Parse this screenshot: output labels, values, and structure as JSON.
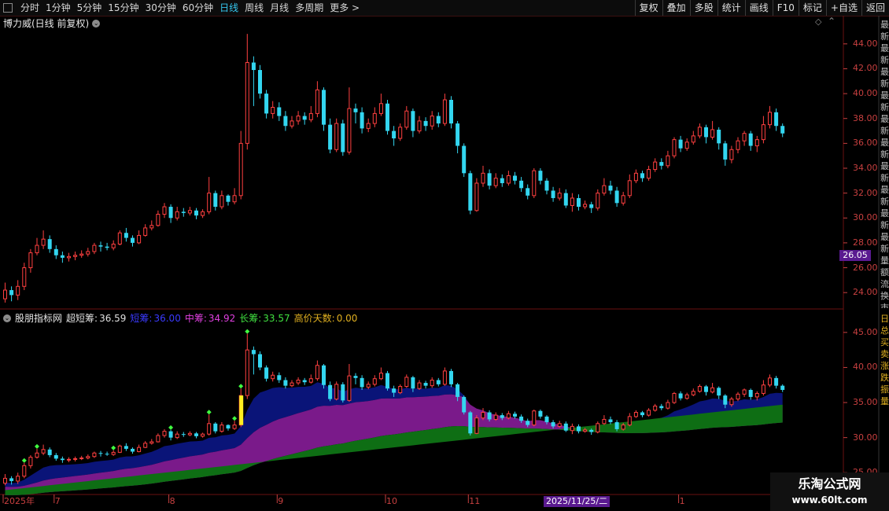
{
  "toolbar": {
    "periods": [
      "分时",
      "1分钟",
      "5分钟",
      "15分钟",
      "30分钟",
      "60分钟",
      "日线",
      "周线",
      "月线",
      "多周期",
      "更多 >"
    ],
    "active_period": "日线",
    "right_buttons": [
      "复权",
      "叠加",
      "多股",
      "统计",
      "画线",
      "F10",
      "标记",
      "+自选",
      "返回"
    ]
  },
  "main_panel": {
    "title": "博力威(日线 前复权)",
    "y_ticks": [
      "44.00",
      "42.00",
      "40.00",
      "38.00",
      "36.00",
      "34.00",
      "32.00",
      "30.00",
      "28.00",
      "26.00",
      "24.00"
    ],
    "price_tag": "26.05"
  },
  "indicator_panel": {
    "name": "股朋指标网",
    "items": [
      {
        "label": "超短筹:",
        "value": "36.59",
        "color": "#e0e0e0"
      },
      {
        "label": "短筹:",
        "value": "36.00",
        "color": "#3a3aff"
      },
      {
        "label": "中筹:",
        "value": "34.92",
        "color": "#e040e0"
      },
      {
        "label": "长筹:",
        "value": "33.57",
        "color": "#40e040"
      },
      {
        "label": "高价天数:",
        "value": "0.00",
        "color": "#e0b020"
      }
    ],
    "y_ticks": [
      "45.00",
      "40.00",
      "35.00",
      "30.00",
      "25.00"
    ]
  },
  "x_axis": {
    "labels": [
      "2025年",
      "7",
      "8",
      "9",
      "10",
      "11",
      "1"
    ],
    "cursor_date": "2025/11/25/二"
  },
  "side_text": {
    "upper": "最新最新最新最新最新最新最新最新最新最新量额流换市收",
    "lower": "日总买卖涨跌振量"
  },
  "watermark": {
    "title": "乐淘公式网",
    "url": "www.60lt.com"
  },
  "colors": {
    "up": "#ff4040",
    "down": "#33d6f0",
    "grid": "#6a1010",
    "axis": "#c84040",
    "chip_short": "#0a1478",
    "chip_mid": "#7a1a8a",
    "chip_long": "#0e6e14",
    "high_bar": "#ffee20",
    "marker": "#40ff40"
  },
  "chart_data": {
    "type": "candlestick",
    "ylim": [
      23,
      45
    ],
    "indicator_ylim": [
      22,
      47
    ],
    "candles": [
      [
        23.5,
        24.2,
        24.8,
        23.2
      ],
      [
        24.2,
        23.8,
        24.5,
        23.3
      ],
      [
        23.8,
        24.5,
        25.0,
        23.4
      ],
      [
        24.5,
        26.0,
        26.4,
        24.2
      ],
      [
        26.0,
        27.2,
        27.5,
        25.6
      ],
      [
        27.2,
        27.8,
        28.4,
        27.0
      ],
      [
        27.8,
        28.3,
        29.0,
        27.5
      ],
      [
        28.3,
        27.5,
        28.6,
        27.2
      ],
      [
        27.5,
        27.0,
        27.8,
        26.7
      ],
      [
        27.0,
        26.8,
        27.3,
        26.4
      ],
      [
        26.8,
        26.9,
        27.2,
        26.5
      ],
      [
        26.9,
        27.0,
        27.3,
        26.6
      ],
      [
        27.0,
        27.1,
        27.4,
        26.8
      ],
      [
        27.1,
        27.3,
        27.6,
        26.9
      ],
      [
        27.3,
        27.8,
        28.0,
        27.1
      ],
      [
        27.8,
        27.7,
        28.1,
        27.3
      ],
      [
        27.7,
        27.6,
        28.0,
        27.4
      ],
      [
        27.6,
        27.9,
        28.2,
        27.4
      ],
      [
        27.9,
        28.8,
        29.0,
        27.8
      ],
      [
        28.8,
        28.4,
        29.2,
        28.1
      ],
      [
        28.4,
        28.0,
        28.6,
        27.7
      ],
      [
        28.0,
        28.6,
        29.0,
        27.9
      ],
      [
        28.6,
        29.2,
        29.5,
        28.5
      ],
      [
        29.2,
        29.4,
        29.8,
        29.0
      ],
      [
        29.4,
        30.3,
        30.6,
        29.3
      ],
      [
        30.3,
        30.9,
        31.2,
        30.0
      ],
      [
        30.9,
        30.0,
        31.1,
        29.6
      ],
      [
        30.0,
        30.5,
        30.9,
        29.8
      ],
      [
        30.5,
        30.4,
        30.8,
        30.1
      ],
      [
        30.4,
        30.6,
        30.9,
        30.2
      ],
      [
        30.6,
        30.2,
        30.8,
        29.9
      ],
      [
        30.2,
        30.5,
        30.7,
        30.0
      ],
      [
        30.5,
        32.0,
        33.3,
        30.3
      ],
      [
        32.0,
        30.9,
        32.2,
        30.6
      ],
      [
        30.9,
        31.8,
        32.2,
        30.7
      ],
      [
        31.8,
        31.3,
        31.9,
        31.0
      ],
      [
        31.3,
        31.8,
        32.4,
        31.1
      ],
      [
        31.8,
        36.0,
        37.0,
        31.5
      ],
      [
        36.0,
        42.5,
        44.8,
        35.5
      ],
      [
        42.5,
        41.9,
        43.0,
        39.0
      ],
      [
        41.9,
        40.0,
        42.3,
        39.6
      ],
      [
        40.0,
        38.4,
        40.3,
        38.0
      ],
      [
        38.4,
        38.9,
        39.4,
        38.0
      ],
      [
        38.9,
        38.2,
        39.3,
        37.8
      ],
      [
        38.2,
        37.4,
        38.6,
        37.0
      ],
      [
        37.4,
        37.8,
        38.2,
        37.2
      ],
      [
        37.8,
        38.2,
        38.6,
        37.5
      ],
      [
        38.2,
        37.9,
        38.5,
        37.5
      ],
      [
        37.9,
        38.4,
        39.0,
        37.7
      ],
      [
        38.4,
        40.3,
        41.0,
        38.1
      ],
      [
        40.3,
        37.5,
        40.5,
        37.0
      ],
      [
        37.5,
        35.5,
        38.0,
        35.2
      ],
      [
        35.5,
        37.6,
        38.0,
        35.3
      ],
      [
        37.6,
        35.3,
        37.9,
        35.0
      ],
      [
        35.3,
        38.8,
        40.5,
        35.1
      ],
      [
        38.8,
        38.5,
        39.2,
        37.6
      ],
      [
        38.5,
        37.2,
        38.9,
        36.8
      ],
      [
        37.2,
        37.6,
        38.0,
        36.9
      ],
      [
        37.6,
        38.4,
        38.9,
        37.3
      ],
      [
        38.4,
        39.2,
        40.0,
        38.2
      ],
      [
        39.2,
        37.0,
        39.5,
        36.7
      ],
      [
        37.0,
        36.4,
        37.4,
        35.8
      ],
      [
        36.4,
        37.3,
        37.6,
        36.2
      ],
      [
        37.3,
        38.6,
        39.0,
        37.1
      ],
      [
        38.6,
        37.0,
        38.8,
        36.5
      ],
      [
        37.0,
        37.8,
        38.2,
        36.8
      ],
      [
        37.8,
        37.4,
        38.1,
        37.0
      ],
      [
        37.4,
        38.2,
        38.6,
        37.1
      ],
      [
        38.2,
        37.6,
        38.5,
        37.3
      ],
      [
        37.6,
        39.5,
        40.0,
        37.4
      ],
      [
        39.5,
        37.6,
        39.8,
        37.2
      ],
      [
        37.6,
        35.8,
        37.8,
        35.2
      ],
      [
        35.8,
        33.6,
        36.0,
        33.3
      ],
      [
        33.6,
        30.6,
        33.8,
        30.3
      ],
      [
        30.6,
        32.8,
        33.2,
        30.5
      ],
      [
        32.8,
        33.6,
        34.2,
        32.5
      ],
      [
        33.6,
        32.6,
        33.9,
        32.3
      ],
      [
        32.6,
        33.2,
        33.6,
        32.4
      ],
      [
        33.2,
        32.8,
        33.5,
        32.5
      ],
      [
        32.8,
        33.4,
        33.8,
        32.6
      ],
      [
        33.4,
        33.0,
        33.7,
        32.7
      ],
      [
        33.0,
        32.4,
        33.3,
        32.1
      ],
      [
        32.4,
        31.8,
        32.7,
        31.5
      ],
      [
        31.8,
        33.8,
        34.0,
        31.6
      ],
      [
        33.8,
        33.0,
        34.0,
        32.7
      ],
      [
        33.0,
        32.2,
        33.2,
        31.9
      ],
      [
        32.2,
        31.6,
        32.5,
        31.3
      ],
      [
        31.6,
        32.0,
        32.4,
        31.4
      ],
      [
        32.0,
        31.0,
        32.3,
        30.8
      ],
      [
        31.0,
        31.6,
        32.0,
        30.5
      ],
      [
        31.6,
        30.9,
        31.9,
        30.6
      ],
      [
        30.9,
        31.1,
        31.4,
        30.7
      ],
      [
        31.1,
        30.8,
        31.3,
        30.4
      ],
      [
        30.8,
        32.0,
        32.3,
        30.6
      ],
      [
        32.0,
        32.6,
        33.2,
        31.8
      ],
      [
        32.6,
        32.2,
        33.0,
        31.9
      ],
      [
        32.2,
        31.2,
        32.5,
        30.9
      ],
      [
        31.2,
        31.8,
        32.1,
        31.0
      ],
      [
        31.8,
        33.0,
        33.5,
        31.6
      ],
      [
        33.0,
        33.6,
        33.9,
        32.8
      ],
      [
        33.6,
        33.2,
        33.8,
        32.9
      ],
      [
        33.2,
        33.9,
        34.2,
        33.0
      ],
      [
        33.9,
        34.5,
        34.8,
        33.7
      ],
      [
        34.5,
        34.2,
        34.8,
        33.9
      ],
      [
        34.2,
        35.0,
        35.4,
        34.0
      ],
      [
        35.0,
        36.3,
        36.5,
        34.8
      ],
      [
        36.3,
        35.6,
        36.6,
        35.3
      ],
      [
        35.6,
        36.1,
        36.4,
        35.4
      ],
      [
        36.1,
        36.6,
        37.0,
        35.9
      ],
      [
        36.6,
        37.3,
        37.6,
        36.4
      ],
      [
        37.3,
        36.5,
        37.5,
        36.0
      ],
      [
        36.5,
        37.1,
        37.8,
        36.3
      ],
      [
        37.1,
        36.0,
        37.3,
        35.5
      ],
      [
        36.0,
        34.7,
        36.2,
        34.2
      ],
      [
        34.7,
        35.5,
        35.8,
        34.4
      ],
      [
        35.5,
        36.2,
        36.5,
        35.2
      ],
      [
        36.2,
        36.8,
        37.0,
        35.8
      ],
      [
        36.8,
        35.8,
        37.0,
        35.4
      ],
      [
        35.8,
        36.3,
        36.6,
        35.3
      ],
      [
        36.3,
        37.5,
        38.2,
        36.0
      ],
      [
        37.5,
        38.5,
        39.0,
        37.2
      ],
      [
        38.5,
        37.4,
        38.8,
        37.0
      ],
      [
        37.4,
        36.8,
        37.6,
        36.5
      ]
    ],
    "high_bar_index": 37,
    "marker_indices": [
      3,
      5,
      17,
      26,
      32,
      36,
      37,
      38
    ]
  }
}
